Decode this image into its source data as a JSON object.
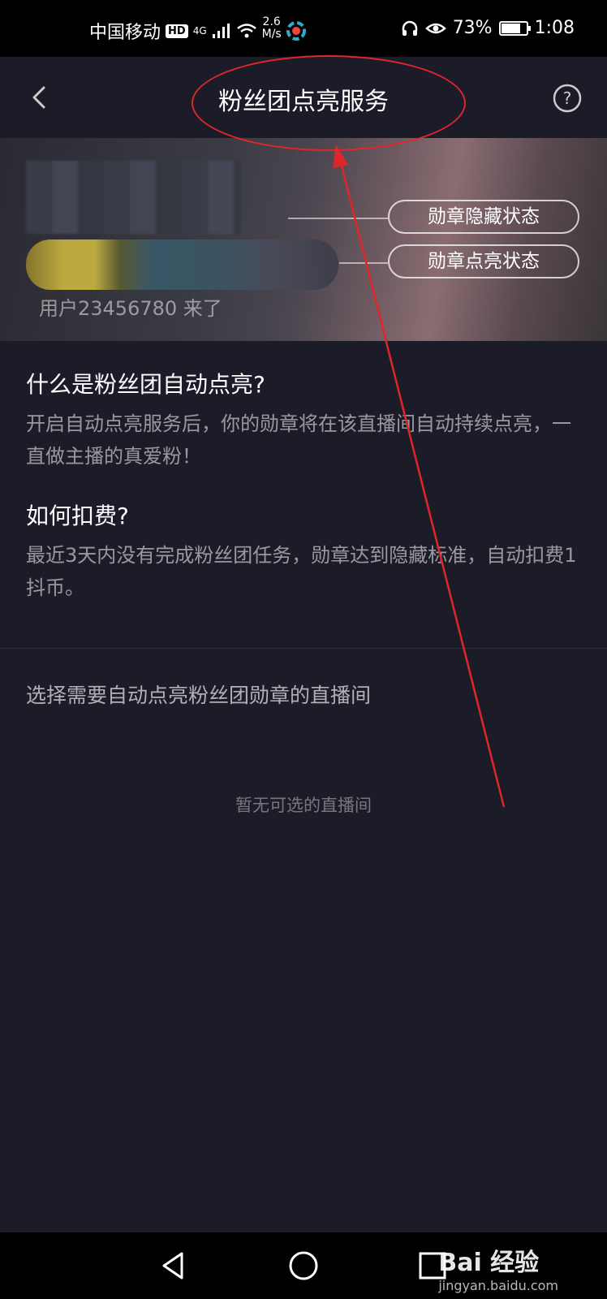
{
  "status_bar": {
    "carrier": "中国移动",
    "hd": "HD",
    "network": "4G",
    "speed_value": "2.6",
    "speed_unit": "M/s",
    "battery_percent": "73%",
    "battery_level": 0.73,
    "time": "1:08"
  },
  "header": {
    "title": "粉丝团点亮服务"
  },
  "banner": {
    "user_line": "用户23456780 来了",
    "badge_hidden_label": "勋章隐藏状态",
    "badge_lit_label": "勋章点亮状态"
  },
  "faq": [
    {
      "question": "什么是粉丝团自动点亮?",
      "answer": "开启自动点亮服务后，你的勋章将在该直播间自动持续点亮，一直做主播的真爱粉！"
    },
    {
      "question": "如何扣费?",
      "answer": "最近3天内没有完成粉丝团任务，勋章达到隐藏标准，自动扣费1抖币。"
    }
  ],
  "rooms": {
    "title": "选择需要自动点亮粉丝团勋章的直播间",
    "empty_text": "暂无可选的直播间"
  },
  "watermark": {
    "brand": "Bai  经验",
    "url": "jingyan.baidu.com"
  },
  "colors": {
    "background": "#1c1c28",
    "annotation": "#e0262b"
  }
}
